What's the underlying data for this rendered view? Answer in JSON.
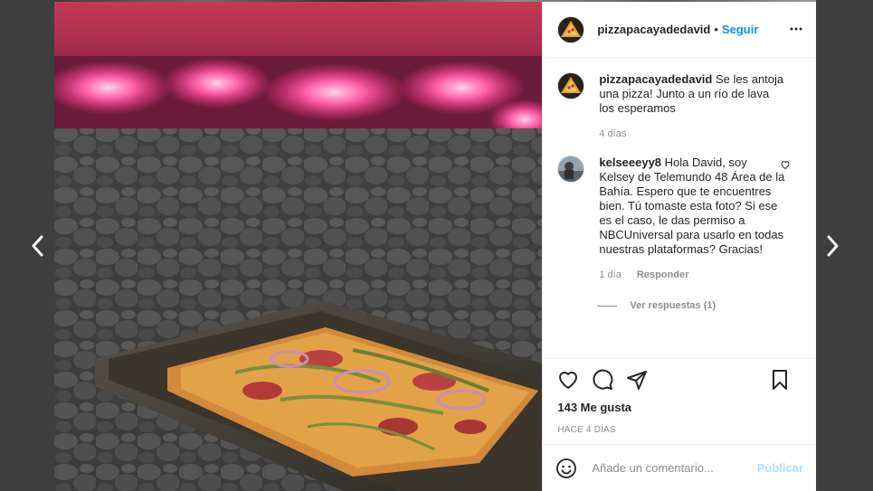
{
  "post": {
    "username": "pizzapacayadedavid",
    "follow_label": "Seguir",
    "caption": "Se les antoja una pizza! Junto a un río de lava los esperamos",
    "caption_time": "4 días",
    "likes": "143 Me gusta",
    "posted": "HACE 4 DÍAS"
  },
  "comments": [
    {
      "username": "kelseeeyy8",
      "text": "Hola David, soy Kelsey de Telemundo 48 Área de la Bahía. Espero que te encuentres bien. Tú tomaste esta foto? Si ese es el caso, le das permiso a NBCUniversal para usarlo en todas nuestras plataformas? Gracias!",
      "time": "1 día",
      "reply_label": "Responder",
      "view_replies": "Ver respuestas (1)"
    }
  ],
  "composer": {
    "placeholder": "Añade un comentario...",
    "publish_label": "Publicar"
  },
  "icons": [
    "chevron-left-icon",
    "chevron-right-icon",
    "more-icon",
    "heart-icon",
    "comment-icon",
    "share-icon",
    "bookmark-icon",
    "emoji-icon"
  ],
  "colors": {
    "accent": "#0095f6",
    "publish_disabled": "#b2dffc"
  }
}
